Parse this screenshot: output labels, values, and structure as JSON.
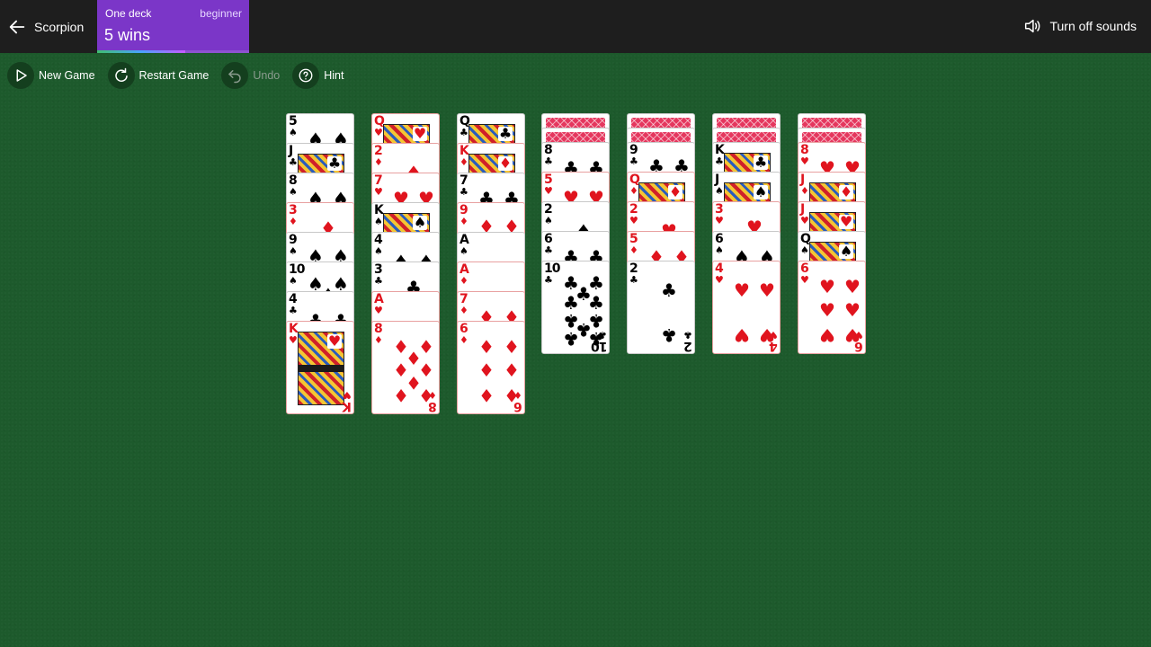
{
  "header": {
    "back_label": "Scorpion",
    "mode": "One deck",
    "level": "beginner",
    "wins": "5 wins",
    "progress_fraction": 0.58,
    "sound_label": "Turn off sounds"
  },
  "toolbar": {
    "new_game": "New Game",
    "restart": "Restart Game",
    "undo": "Undo",
    "hint": "Hint"
  },
  "colors": {
    "table_green": "#1d5a2c",
    "top_bar": "#1e1e1e",
    "mode_purple": "#7b36c8",
    "suit_red": "#e0141e"
  },
  "tableau": [
    {
      "hidden": 0,
      "cards": [
        {
          "r": "5",
          "s": "♠"
        },
        {
          "r": "J",
          "s": "♣"
        },
        {
          "r": "8",
          "s": "♠"
        },
        {
          "r": "3",
          "s": "♦"
        },
        {
          "r": "9",
          "s": "♠"
        },
        {
          "r": "10",
          "s": "♠"
        },
        {
          "r": "4",
          "s": "♣"
        },
        {
          "r": "K",
          "s": "♥"
        }
      ]
    },
    {
      "hidden": 0,
      "cards": [
        {
          "r": "Q",
          "s": "♥"
        },
        {
          "r": "2",
          "s": "♦"
        },
        {
          "r": "7",
          "s": "♥"
        },
        {
          "r": "K",
          "s": "♠"
        },
        {
          "r": "4",
          "s": "♠"
        },
        {
          "r": "3",
          "s": "♣"
        },
        {
          "r": "A",
          "s": "♥"
        },
        {
          "r": "8",
          "s": "♦"
        }
      ]
    },
    {
      "hidden": 0,
      "cards": [
        {
          "r": "Q",
          "s": "♣"
        },
        {
          "r": "K",
          "s": "♦"
        },
        {
          "r": "7",
          "s": "♣"
        },
        {
          "r": "9",
          "s": "♦"
        },
        {
          "r": "A",
          "s": "♠"
        },
        {
          "r": "A",
          "s": "♦"
        },
        {
          "r": "7",
          "s": "♦"
        },
        {
          "r": "6",
          "s": "♦"
        }
      ]
    },
    {
      "hidden": 2,
      "cards": [
        {
          "r": "8",
          "s": "♣"
        },
        {
          "r": "5",
          "s": "♥"
        },
        {
          "r": "2",
          "s": "♠"
        },
        {
          "r": "6",
          "s": "♣"
        },
        {
          "r": "10",
          "s": "♣"
        }
      ]
    },
    {
      "hidden": 2,
      "cards": [
        {
          "r": "9",
          "s": "♣"
        },
        {
          "r": "Q",
          "s": "♦"
        },
        {
          "r": "2",
          "s": "♥"
        },
        {
          "r": "5",
          "s": "♦"
        },
        {
          "r": "2",
          "s": "♣"
        }
      ]
    },
    {
      "hidden": 2,
      "cards": [
        {
          "r": "K",
          "s": "♣"
        },
        {
          "r": "J",
          "s": "♠"
        },
        {
          "r": "3",
          "s": "♥"
        },
        {
          "r": "6",
          "s": "♠"
        },
        {
          "r": "4",
          "s": "♥"
        }
      ]
    },
    {
      "hidden": 2,
      "cards": [
        {
          "r": "8",
          "s": "♥"
        },
        {
          "r": "J",
          "s": "♦"
        },
        {
          "r": "J",
          "s": "♥"
        },
        {
          "r": "Q",
          "s": "♠"
        },
        {
          "r": "6",
          "s": "♥"
        }
      ]
    }
  ]
}
